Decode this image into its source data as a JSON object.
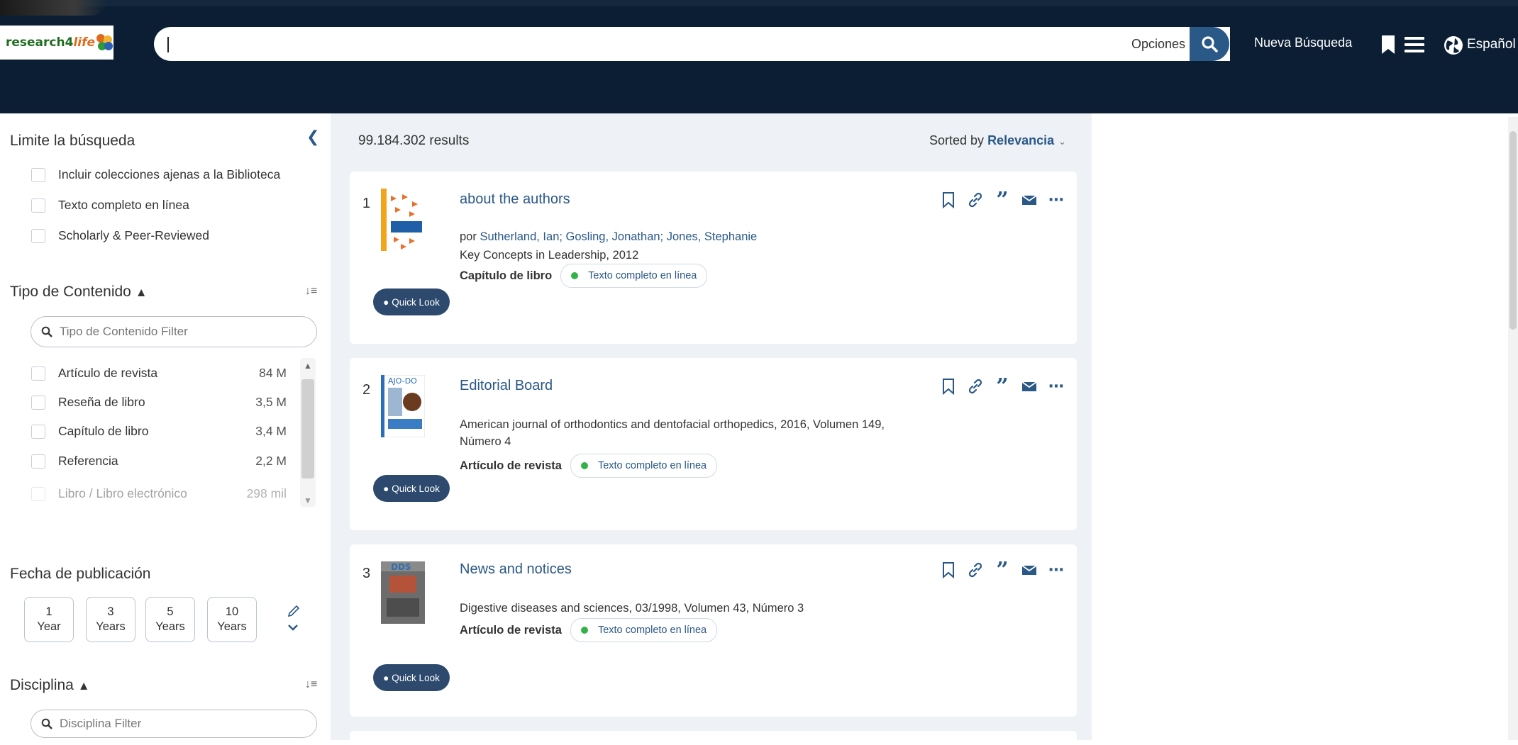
{
  "header": {
    "logo_text_a": "research4",
    "logo_text_b": "life",
    "search_value": "",
    "options_label": "Opciones",
    "new_search_label": "Nueva Búsqueda",
    "language_label": "Español"
  },
  "sidebar": {
    "limit_title": "Limite la búsqueda",
    "limit_options": [
      "Incluir colecciones ajenas a la Biblioteca",
      "Texto completo en línea",
      "Scholarly & Peer-Reviewed"
    ],
    "content_type_title": "Tipo de Contenido",
    "content_type_filter_placeholder": "Tipo de Contenido Filter",
    "content_types": [
      {
        "label": "Artículo de revista",
        "count": "84 M"
      },
      {
        "label": "Reseña de libro",
        "count": "3,5 M"
      },
      {
        "label": "Capítulo de libro",
        "count": "3,4 M"
      },
      {
        "label": "Referencia",
        "count": "2,2 M"
      },
      {
        "label": "Libro / Libro electrónico",
        "count": "298 mil"
      }
    ],
    "date_title": "Fecha de publicación",
    "year_buttons": [
      {
        "n": "1",
        "unit": "Year"
      },
      {
        "n": "3",
        "unit": "Years"
      },
      {
        "n": "5",
        "unit": "Years"
      },
      {
        "n": "10",
        "unit": "Years"
      }
    ],
    "discipline_title": "Disciplina",
    "discipline_filter_placeholder": "Disciplina Filter"
  },
  "results": {
    "count_label": "99.184.302 results",
    "sorted_prefix": "Sorted by",
    "sorted_value": "Relevancia",
    "quick_look_label": "Quick Look",
    "items": [
      {
        "num": "1",
        "title": "about the authors",
        "by_prefix": "por",
        "authors": "Sutherland, Ian; Gosling, Jonathan; Jones, Stephanie",
        "source": "Key Concepts in Leadership, 2012",
        "type": "Capítulo de libro",
        "availability": "Texto completo en línea"
      },
      {
        "num": "2",
        "title": "Editorial Board",
        "source_line1": "American journal of orthodontics and dentofacial orthopedics, 2016, Volumen 149,",
        "source_line2": "Número 4",
        "type": "Artículo de revista",
        "availability": "Texto completo en línea",
        "thumb_text": "AJO-DO"
      },
      {
        "num": "3",
        "title": "News and notices",
        "source": "Digestive diseases and sciences, 03/1998, Volumen 43, Número 3",
        "type": "Artículo de revista",
        "availability": "Texto completo en línea",
        "thumb_text": "DDS"
      }
    ]
  },
  "colors": {
    "header_bg": "#0b1e33",
    "accent": "#2a5887",
    "quick_look_bg": "#2d4a6e",
    "available_dot": "#33b249",
    "results_bg": "#eef1f5"
  }
}
